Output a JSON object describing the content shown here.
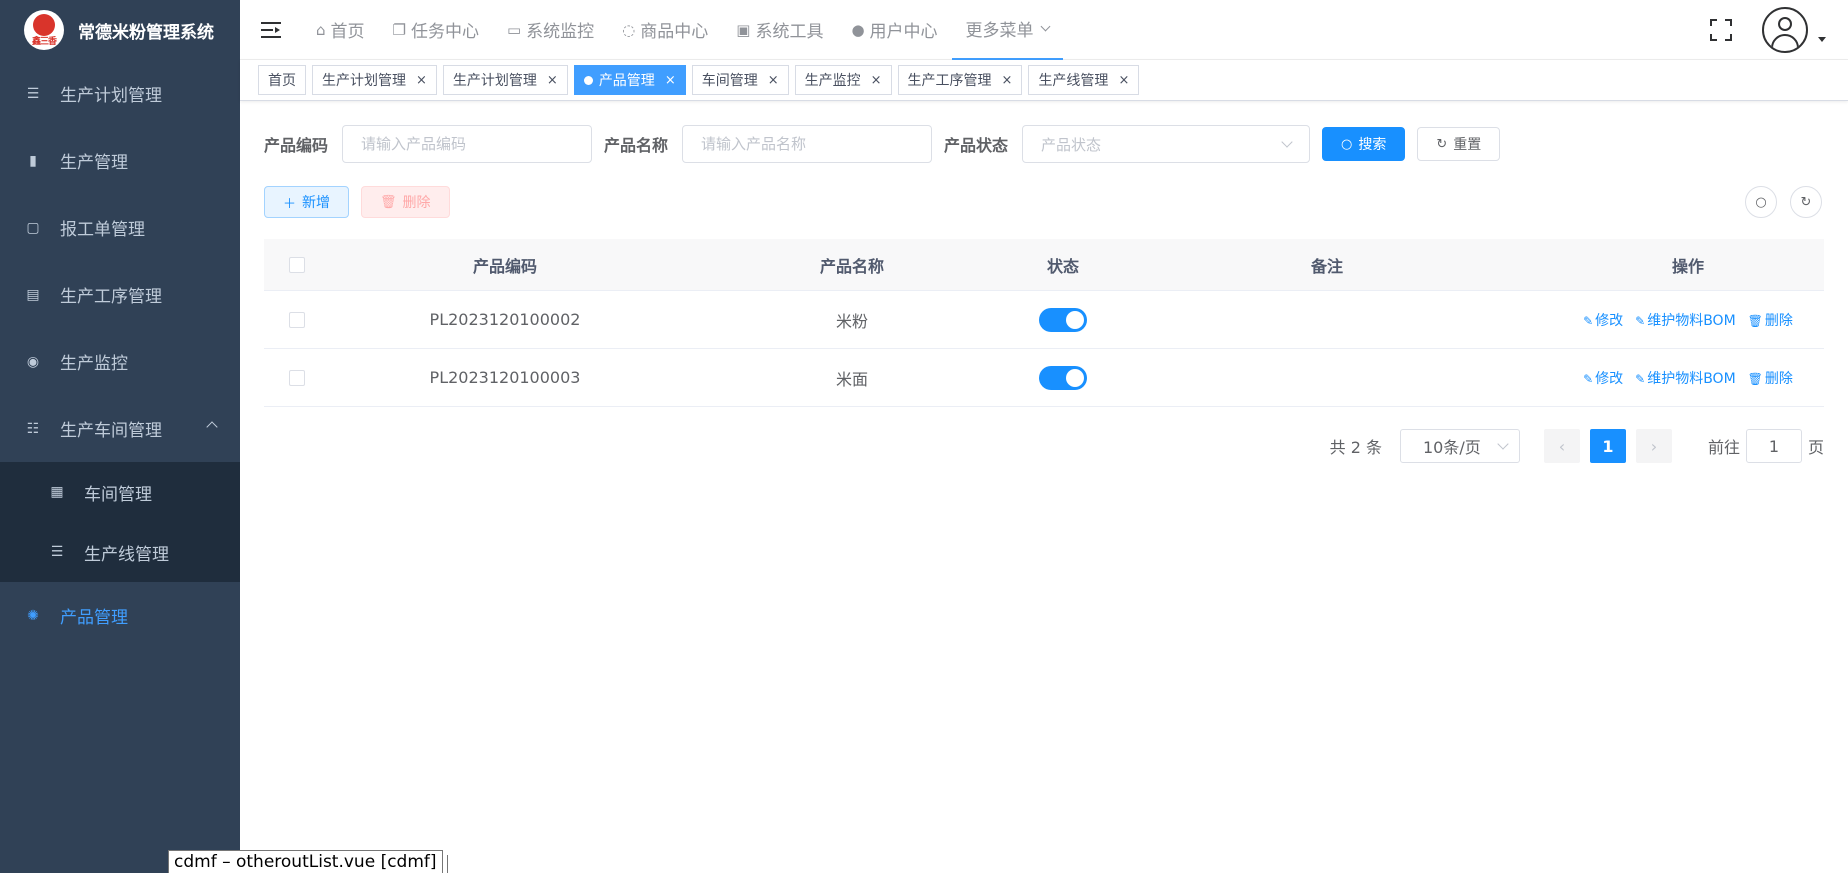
{
  "app": {
    "logo_text": "鑫三香",
    "title": "常德米粉管理系统"
  },
  "sidebar": {
    "items": [
      {
        "label": "生产计划管理",
        "icon": "list-icon"
      },
      {
        "label": "生产管理",
        "icon": "book-icon"
      },
      {
        "label": "报工单管理",
        "icon": "form-icon"
      },
      {
        "label": "生产工序管理",
        "icon": "clipboard-icon"
      },
      {
        "label": "生产监控",
        "icon": "eye-icon"
      },
      {
        "label": "生产车间管理",
        "icon": "tree-table-icon"
      }
    ],
    "submenu": [
      {
        "label": "车间管理",
        "icon": "table-icon"
      },
      {
        "label": "生产线管理",
        "icon": "list-icon"
      }
    ],
    "active_item": {
      "label": "产品管理",
      "icon": "chrome-icon"
    }
  },
  "navbar": {
    "menus": [
      {
        "label": "首页",
        "icon": "puzzle-icon"
      },
      {
        "label": "任务中心",
        "icon": "documents-icon"
      },
      {
        "label": "系统监控",
        "icon": "monitor-icon"
      },
      {
        "label": "商品中心",
        "icon": "goods-icon"
      },
      {
        "label": "系统工具",
        "icon": "toolbox-icon"
      },
      {
        "label": "用户中心",
        "icon": "user-icon"
      }
    ],
    "more": "更多菜单"
  },
  "tags": [
    {
      "label": "首页",
      "closable": false,
      "active": false
    },
    {
      "label": "生产计划管理",
      "closable": true,
      "active": false
    },
    {
      "label": "生产计划管理",
      "closable": true,
      "active": false
    },
    {
      "label": "产品管理",
      "closable": true,
      "active": true
    },
    {
      "label": "车间管理",
      "closable": true,
      "active": false
    },
    {
      "label": "生产监控",
      "closable": true,
      "active": false
    },
    {
      "label": "生产工序管理",
      "closable": true,
      "active": false
    },
    {
      "label": "生产线管理",
      "closable": true,
      "active": false
    }
  ],
  "search": {
    "code_label": "产品编码",
    "code_placeholder": "请输入产品编码",
    "name_label": "产品名称",
    "name_placeholder": "请输入产品名称",
    "status_label": "产品状态",
    "status_placeholder": "产品状态",
    "search_btn": "搜索",
    "reset_btn": "重置"
  },
  "toolbar": {
    "add_btn": "新增",
    "delete_btn": "删除"
  },
  "table": {
    "headers": {
      "code": "产品编码",
      "name": "产品名称",
      "status": "状态",
      "remark": "备注",
      "ops": "操作"
    },
    "rows": [
      {
        "code": "PL2023120100002",
        "name": "米粉",
        "status_on": true,
        "remark": ""
      },
      {
        "code": "PL2023120100003",
        "name": "米面",
        "status_on": true,
        "remark": ""
      }
    ],
    "ops": {
      "edit": "修改",
      "bom": "维护物料BOM",
      "delete": "删除"
    }
  },
  "pagination": {
    "total_text": "共 2 条",
    "page_size": "10条/页",
    "current_page": "1",
    "goto_label": "前往",
    "goto_value": "1",
    "page_suffix": "页"
  },
  "status_tooltip": "cdmf – otheroutList.vue [cdmf]"
}
